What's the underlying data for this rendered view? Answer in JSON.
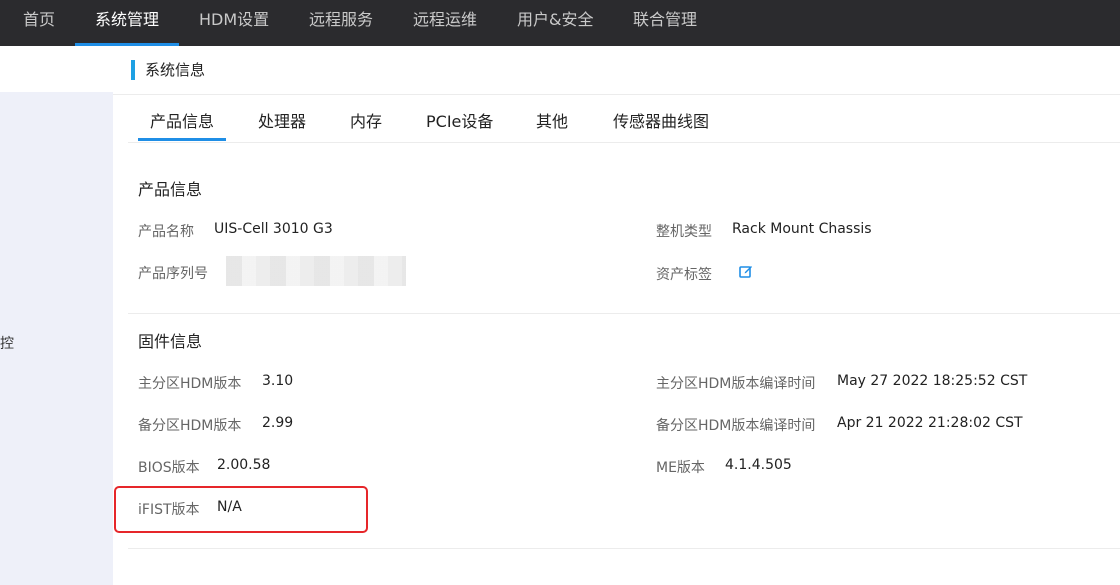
{
  "topnav": {
    "items": [
      {
        "label": "首页"
      },
      {
        "label": "系统管理"
      },
      {
        "label": "HDM设置"
      },
      {
        "label": "远程服务"
      },
      {
        "label": "远程运维"
      },
      {
        "label": "用户&安全"
      },
      {
        "label": "联合管理"
      }
    ],
    "active_index": 1
  },
  "sidebar": {
    "visible_text": "控"
  },
  "section": {
    "title": "系统信息"
  },
  "tabs": {
    "items": [
      "产品信息",
      "处理器",
      "内存",
      "PCIe设备",
      "其他",
      "传感器曲线图"
    ],
    "active_index": 0
  },
  "product_info": {
    "title": "产品信息",
    "product_name_label": "产品名称",
    "product_name_value": "UIS-Cell 3010 G3",
    "chassis_type_label": "整机类型",
    "chassis_type_value": "Rack Mount Chassis",
    "serial_label": "产品序列号",
    "asset_tag_label": "资产标签"
  },
  "firmware_info": {
    "title": "固件信息",
    "primary_hdm_label": "主分区HDM版本",
    "primary_hdm_value": "3.10",
    "primary_hdm_build_label": "主分区HDM版本编译时间",
    "primary_hdm_build_value": "May 27 2022 18:25:52 CST",
    "backup_hdm_label": "备分区HDM版本",
    "backup_hdm_value": "2.99",
    "backup_hdm_build_label": "备分区HDM版本编译时间",
    "backup_hdm_build_value": "Apr 21 2022 21:28:02 CST",
    "bios_label": "BIOS版本",
    "bios_value": "2.00.58",
    "me_label": "ME版本",
    "me_value": "4.1.4.505",
    "ifist_label": "iFIST版本",
    "ifist_value": "N/A"
  },
  "colors": {
    "topnav_bg": "#2b2b2e",
    "accent": "#1f8ee6",
    "highlight_border": "#e6262a",
    "sidebar_bg": "#eef0f9"
  }
}
